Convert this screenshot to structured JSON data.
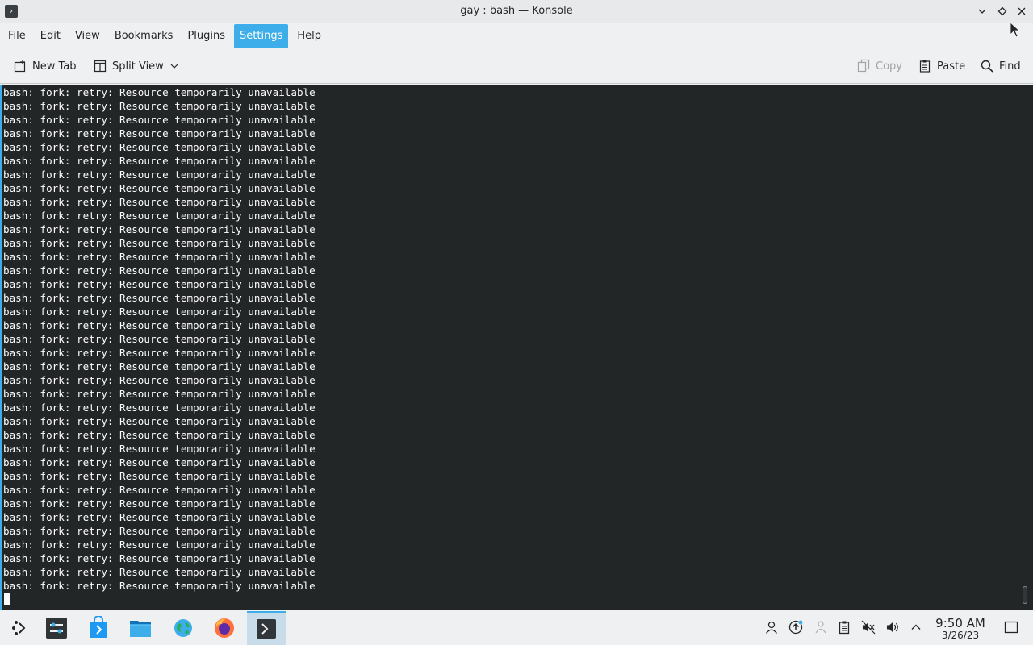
{
  "window": {
    "title": "gay : bash — Konsole"
  },
  "menubar": {
    "items": [
      {
        "label": "File"
      },
      {
        "label": "Edit"
      },
      {
        "label": "View"
      },
      {
        "label": "Bookmarks"
      },
      {
        "label": "Plugins"
      },
      {
        "label": "Settings",
        "active": true
      },
      {
        "label": "Help"
      }
    ]
  },
  "toolbar": {
    "new_tab_label": "New Tab",
    "split_view_label": "Split View",
    "copy_label": "Copy",
    "paste_label": "Paste",
    "find_label": "Find"
  },
  "terminal": {
    "lines": [
      "bash: fork: retry: Resource temporarily unavailable",
      "bash: fork: retry: Resource temporarily unavailable",
      "bash: fork: retry: Resource temporarily unavailable",
      "bash: fork: retry: Resource temporarily unavailable",
      "bash: fork: retry: Resource temporarily unavailable",
      "bash: fork: retry: Resource temporarily unavailable",
      "bash: fork: retry: Resource temporarily unavailable",
      "bash: fork: retry: Resource temporarily unavailable",
      "bash: fork: retry: Resource temporarily unavailable",
      "bash: fork: retry: Resource temporarily unavailable",
      "bash: fork: retry: Resource temporarily unavailable",
      "bash: fork: retry: Resource temporarily unavailable",
      "bash: fork: retry: Resource temporarily unavailable",
      "bash: fork: retry: Resource temporarily unavailable",
      "bash: fork: retry: Resource temporarily unavailable",
      "bash: fork: retry: Resource temporarily unavailable",
      "bash: fork: retry: Resource temporarily unavailable",
      "bash: fork: retry: Resource temporarily unavailable",
      "bash: fork: retry: Resource temporarily unavailable",
      "bash: fork: retry: Resource temporarily unavailable",
      "bash: fork: retry: Resource temporarily unavailable",
      "bash: fork: retry: Resource temporarily unavailable",
      "bash: fork: retry: Resource temporarily unavailable",
      "bash: fork: retry: Resource temporarily unavailable",
      "bash: fork: retry: Resource temporarily unavailable",
      "bash: fork: retry: Resource temporarily unavailable",
      "bash: fork: retry: Resource temporarily unavailable",
      "bash: fork: retry: Resource temporarily unavailable",
      "bash: fork: retry: Resource temporarily unavailable",
      "bash: fork: retry: Resource temporarily unavailable",
      "bash: fork: retry: Resource temporarily unavailable",
      "bash: fork: retry: Resource temporarily unavailable",
      "bash: fork: retry: Resource temporarily unavailable",
      "bash: fork: retry: Resource temporarily unavailable",
      "bash: fork: retry: Resource temporarily unavailable",
      "bash: fork: retry: Resource temporarily unavailable",
      "bash: fork: retry: Resource temporarily unavailable"
    ]
  },
  "taskbar": {
    "apps": [
      {
        "name": "application-launcher-icon"
      },
      {
        "name": "system-settings-icon"
      },
      {
        "name": "discover-store-icon"
      },
      {
        "name": "dolphin-file-manager-icon"
      },
      {
        "name": "web-browser-icon"
      },
      {
        "name": "firefox-icon"
      },
      {
        "name": "konsole-icon",
        "active": true
      }
    ],
    "clock_time": "9:50 AM",
    "clock_date": "3/26/23"
  },
  "colors": {
    "accent": "#3daee9",
    "terminal_bg": "#232627",
    "terminal_fg": "#fcfcfc",
    "chrome_bg": "#eff0f1"
  }
}
